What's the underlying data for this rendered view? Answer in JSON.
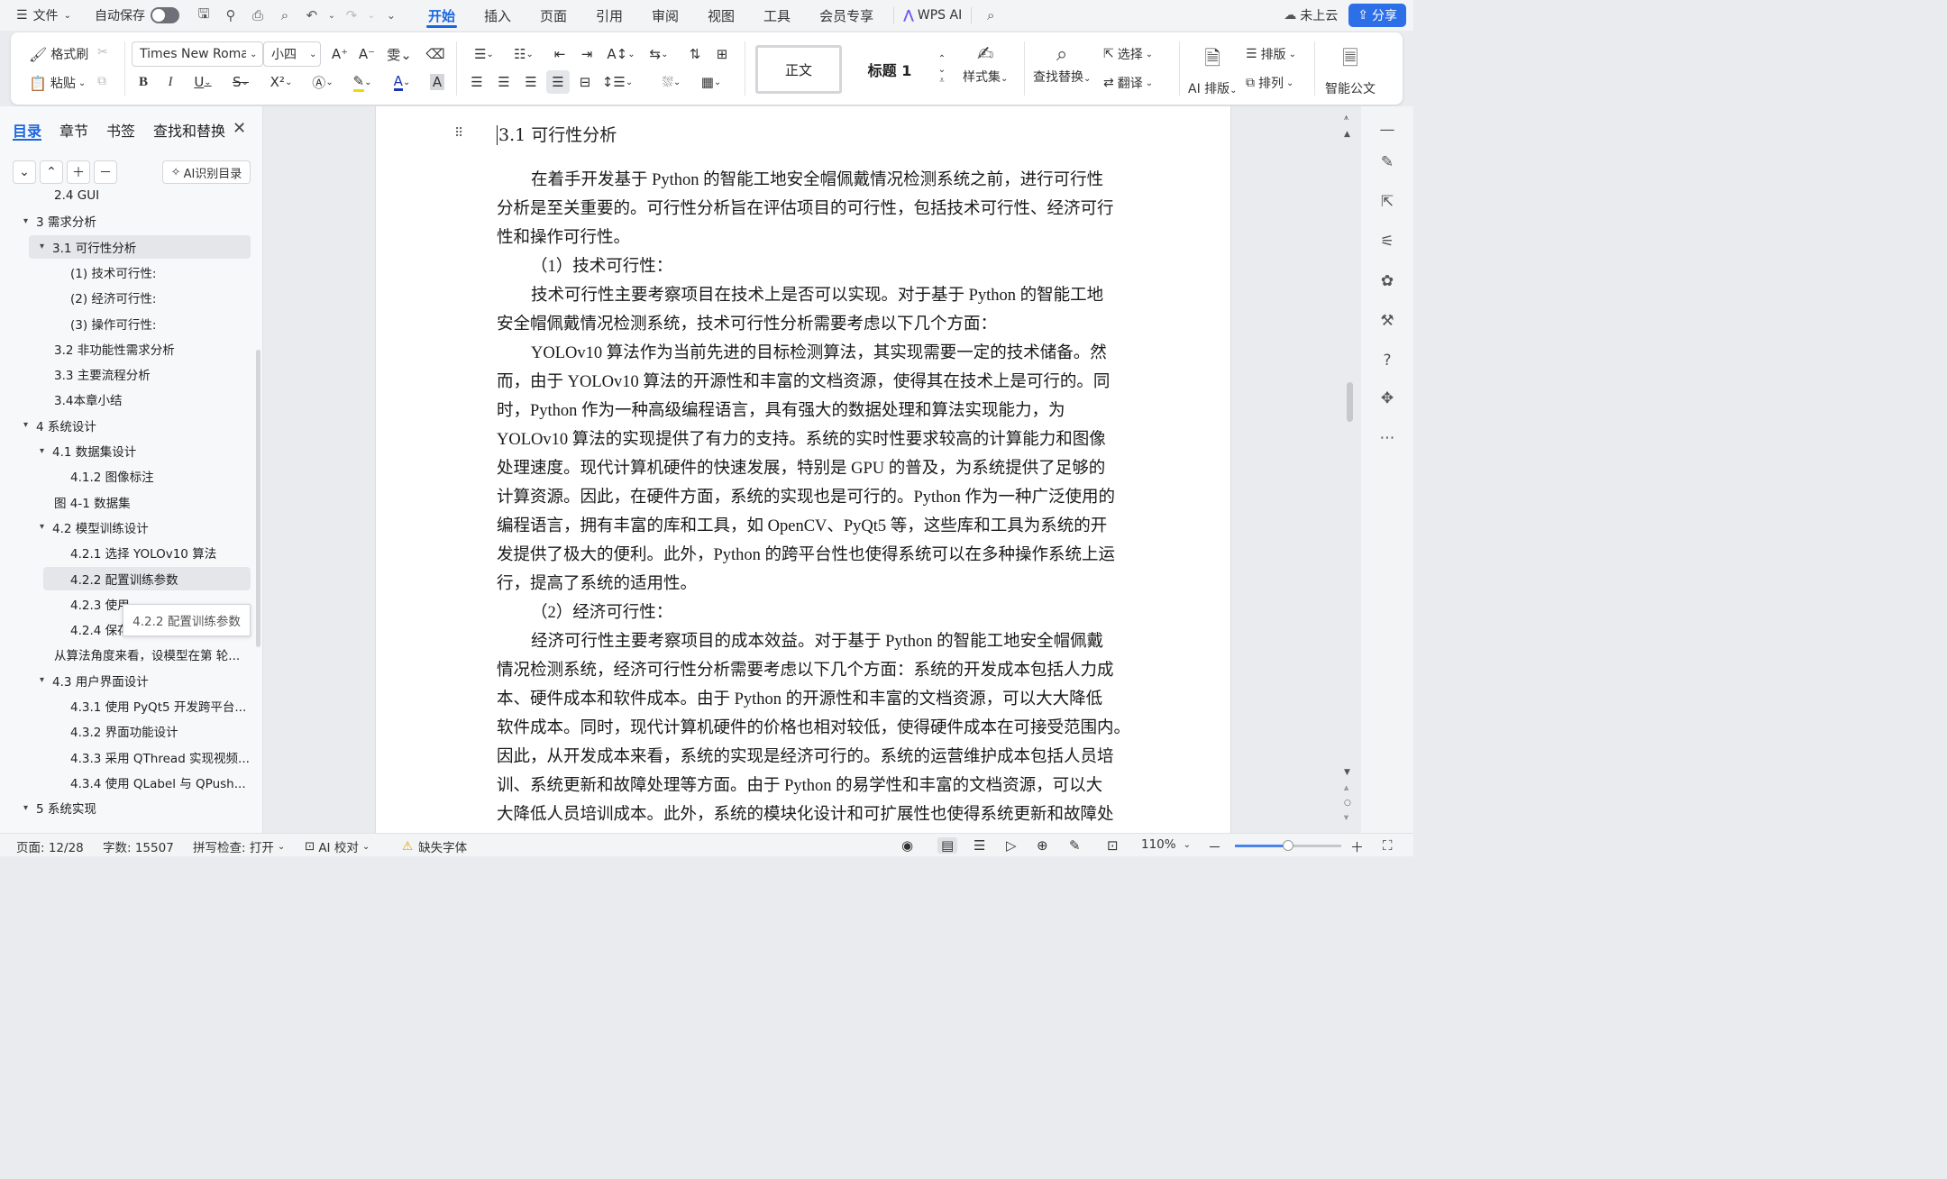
{
  "menubar": {
    "file": "文件",
    "autosave": "自动保存",
    "tabs": [
      "开始",
      "插入",
      "页面",
      "引用",
      "审阅",
      "视图",
      "工具",
      "会员专享"
    ],
    "wps_ai": "WPS AI",
    "cloud": "未上云",
    "share": "分享"
  },
  "ribbon": {
    "format_painter": "格式刷",
    "paste": "粘贴",
    "font_name": "Times New Roman",
    "font_size": "小四",
    "style_normal": "正文",
    "style_heading1": "标题 1",
    "style_set": "样式集",
    "find_replace": "查找替换",
    "select": "选择",
    "translate": "翻译",
    "ai_layout": "AI 排版",
    "typeset": "排版",
    "arrange": "排列",
    "smart_doc": "智能公文",
    "bold": "B",
    "italic": "I",
    "underline": "U",
    "strike": "S",
    "superscript": "X²",
    "font_color_a": "A",
    "char_shade_a": "A"
  },
  "leftpane": {
    "tabs": [
      "目录",
      "章节",
      "书签",
      "查找和替换"
    ],
    "ai_toc": "AI识别目录",
    "tooltip": "4.2.2 配置训练参数",
    "toc": [
      {
        "label": "2.4 GUI",
        "level": 2,
        "caret": ""
      },
      {
        "label": "3  需求分析",
        "level": 1,
        "caret": "▾"
      },
      {
        "label": "3.1 可行性分析",
        "level": 2,
        "caret": "▾",
        "selected": true
      },
      {
        "label": "(1)  技术可行性:",
        "level": 3,
        "caret": ""
      },
      {
        "label": "(2)  经济可行性:",
        "level": 3,
        "caret": ""
      },
      {
        "label": "(3)  操作可行性:",
        "level": 3,
        "caret": ""
      },
      {
        "label": "3.2  非功能性需求分析",
        "level": 2,
        "caret": ""
      },
      {
        "label": "3.3 主要流程分析",
        "level": 2,
        "caret": ""
      },
      {
        "label": "3.4本章小结",
        "level": 2,
        "caret": ""
      },
      {
        "label": "4  系统设计",
        "level": 1,
        "caret": "▾"
      },
      {
        "label": "4.1  数据集设计",
        "level": 2,
        "caret": "▾"
      },
      {
        "label": "4.1.2 图像标注",
        "level": 3,
        "caret": ""
      },
      {
        "label": "图 4-1  数据集",
        "level": 2,
        "caret": ""
      },
      {
        "label": "4.2  模型训练设计",
        "level": 2,
        "caret": "▾"
      },
      {
        "label": "4.2.1  选择  YOLOv10  算法",
        "level": 3,
        "caret": ""
      },
      {
        "label": "4.2.2  配置训练参数",
        "level": 3,
        "caret": "",
        "hover": true
      },
      {
        "label": "4.2.3  使用",
        "level": 3,
        "caret": ""
      },
      {
        "label": "4.2.4  保存",
        "level": 3,
        "caret": ""
      },
      {
        "label": "从算法角度来看，设模型在第  轮...",
        "level": 2,
        "caret": ""
      },
      {
        "label": "4.3 用户界面设计",
        "level": 2,
        "caret": "▾"
      },
      {
        "label": "4.3.1  使用  PyQt5  开发跨平台...",
        "level": 3,
        "caret": ""
      },
      {
        "label": "4.3.2  界面功能设计",
        "level": 3,
        "caret": ""
      },
      {
        "label": "4.3.3  采用  QThread  实现视频...",
        "level": 3,
        "caret": ""
      },
      {
        "label": "4.3.4  使用  QLabel  与  QPush...",
        "level": 3,
        "caret": ""
      },
      {
        "label": "5 系统实现",
        "level": 1,
        "caret": "▾"
      }
    ]
  },
  "document": {
    "heading": "3.1 可行性分析",
    "lines": [
      {
        "text": "在着手开发基于 Python 的智能工地安全帽佩戴情况检测系统之前，进行可行性",
        "indent": true
      },
      {
        "text": "分析是至关重要的。可行性分析旨在评估项目的可行性，包括技术可行性、经济可行",
        "indent": false
      },
      {
        "text": "性和操作可行性。",
        "indent": false
      },
      {
        "text": "（1）技术可行性：",
        "indent": true
      },
      {
        "text": "技术可行性主要考察项目在技术上是否可以实现。对于基于 Python 的智能工地",
        "indent": true
      },
      {
        "text": "安全帽佩戴情况检测系统，技术可行性分析需要考虑以下几个方面：",
        "indent": false
      },
      {
        "text": "YOLOv10 算法作为当前先进的目标检测算法，其实现需要一定的技术储备。然",
        "indent": true
      },
      {
        "text": "而，由于 YOLOv10 算法的开源性和丰富的文档资源，使得其在技术上是可行的。同",
        "indent": false
      },
      {
        "text": "时，Python 作为一种高级编程语言，具有强大的数据处理和算法实现能力，为",
        "indent": false
      },
      {
        "text": "YOLOv10 算法的实现提供了有力的支持。系统的实时性要求较高的计算能力和图像",
        "indent": false
      },
      {
        "text": "处理速度。现代计算机硬件的快速发展，特别是 GPU 的普及，为系统提供了足够的",
        "indent": false
      },
      {
        "text": "计算资源。因此，在硬件方面，系统的实现也是可行的。Python 作为一种广泛使用的",
        "indent": false
      },
      {
        "text": "编程语言，拥有丰富的库和工具，如 OpenCV、PyQt5 等，这些库和工具为系统的开",
        "indent": false
      },
      {
        "text": "发提供了极大的便利。此外，Python 的跨平台性也使得系统可以在多种操作系统上运",
        "indent": false
      },
      {
        "text": "行，提高了系统的适用性。",
        "indent": false
      },
      {
        "text": "（2）经济可行性：",
        "indent": true
      },
      {
        "text": "经济可行性主要考察项目的成本效益。对于基于 Python 的智能工地安全帽佩戴",
        "indent": true
      },
      {
        "text": "情况检测系统，经济可行性分析需要考虑以下几个方面：系统的开发成本包括人力成",
        "indent": false
      },
      {
        "text": "本、硬件成本和软件成本。由于 Python 的开源性和丰富的文档资源，可以大大降低",
        "indent": false
      },
      {
        "text": "软件成本。同时，现代计算机硬件的价格也相对较低，使得硬件成本在可接受范围内。",
        "indent": false
      },
      {
        "text": "因此，从开发成本来看，系统的实现是经济可行的。系统的运营维护成本包括人员培",
        "indent": false
      },
      {
        "text": "训、系统更新和故障处理等方面。由于 Python 的易学性和丰富的文档资源，可以大",
        "indent": false
      },
      {
        "text": "大降低人员培训成本。此外，系统的模块化设计和可扩展性也使得系统更新和故障处",
        "indent": false
      }
    ]
  },
  "statusbar": {
    "page": "页面: 12/28",
    "words": "字数: 15507",
    "spell": "拼写检查: 打开",
    "ai_check": "AI 校对",
    "missing_font": "缺失字体",
    "zoom": "110%",
    "zoom_fraction": 0.5
  },
  "colors": {
    "accent": "#1a66e0",
    "share_bg": "#2d6fe8"
  }
}
